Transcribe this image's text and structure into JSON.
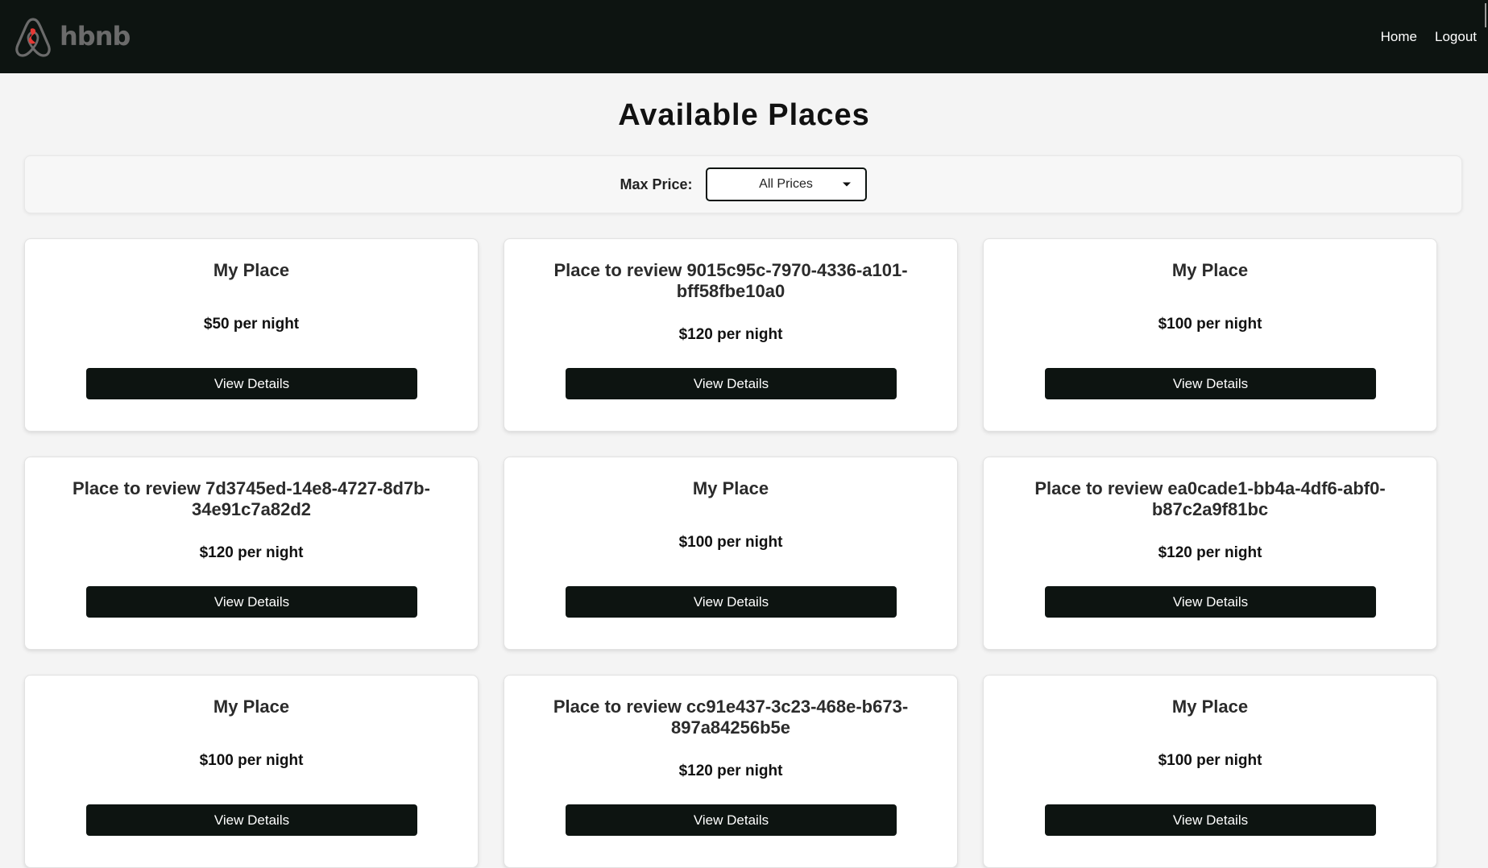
{
  "header": {
    "brand": "hbnb",
    "nav": [
      {
        "label": "Home"
      },
      {
        "label": "Logout"
      }
    ]
  },
  "page": {
    "title": "Available Places"
  },
  "filter": {
    "label": "Max Price:",
    "selected": "All Prices"
  },
  "places": [
    {
      "title": "My Place",
      "price": "$50 per night",
      "button": "View Details"
    },
    {
      "title": "Place to review 9015c95c-7970-4336-a101-bff58fbe10a0",
      "price": "$120 per night",
      "button": "View Details"
    },
    {
      "title": "My Place",
      "price": "$100 per night",
      "button": "View Details"
    },
    {
      "title": "Place to review 7d3745ed-14e8-4727-8d7b-34e91c7a82d2",
      "price": "$120 per night",
      "button": "View Details"
    },
    {
      "title": "My Place",
      "price": "$100 per night",
      "button": "View Details"
    },
    {
      "title": "Place to review ea0cade1-bb4a-4df6-abf0-b87c2a9f81bc",
      "price": "$120 per night",
      "button": "View Details"
    },
    {
      "title": "My Place",
      "price": "$100 per night",
      "button": "View Details"
    },
    {
      "title": "Place to review cc91e437-3c23-468e-b673-897a84256b5e",
      "price": "$120 per night",
      "button": "View Details"
    },
    {
      "title": "My Place",
      "price": "$100 per night",
      "button": "View Details"
    }
  ],
  "colors": {
    "header_bg": "#0d1411",
    "button_bg": "#0d1411",
    "logo_accent": "#e53935",
    "page_bg": "#f4f4f4"
  },
  "icons": {
    "logo": "airbnb-style-logo-icon",
    "select_caret": "caret-down-icon"
  }
}
